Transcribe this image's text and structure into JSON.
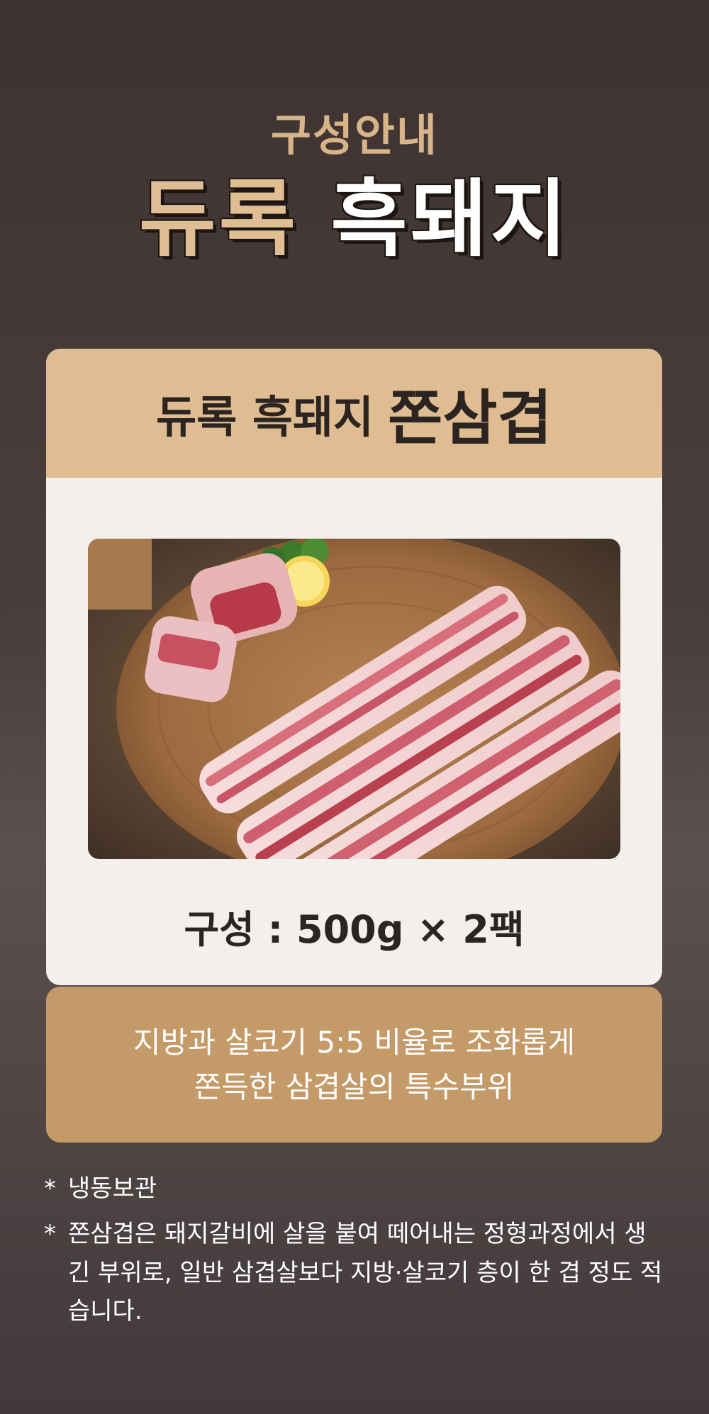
{
  "header": {
    "subtitle": "구성안내",
    "title_part_a": "듀록",
    "title_part_b": "흑돼지"
  },
  "card": {
    "head_small": "듀록 흑돼지",
    "head_big": "쫀삼겹",
    "composition": "구성 : 500g × 2팩"
  },
  "description": {
    "line1": "지방과 살코기 5:5 비율로 조화롭게",
    "line2": "쫀득한 삼겹살의 특수부위"
  },
  "notes": [
    {
      "marker": "*",
      "text": "냉동보관"
    },
    {
      "marker": "*",
      "text": "쫀삼겹은 돼지갈비에 살을 붙여 떼어내는 정형과정에서 생긴 부위로, 일반 삼겹살보다 지방·살코기 층이 한 겹 정도 적습니다."
    }
  ]
}
